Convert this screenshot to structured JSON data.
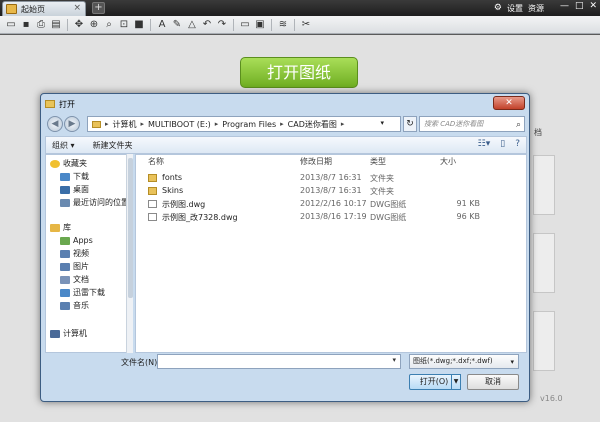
{
  "app": {
    "tab_label": "起始页",
    "tab_close": "×",
    "new_tab": "+",
    "settings": "设置",
    "resources": "资源",
    "win_min": "—",
    "win_max": "□",
    "win_close": "✕"
  },
  "start_page": {
    "open_drawing_label": "打开图纸",
    "side_label": "档",
    "version": "v16.0"
  },
  "dialog": {
    "title": "打开",
    "address": [
      "计算机",
      "MULTIBOOT (E:)",
      "Program Files",
      "CAD迷你看图"
    ],
    "search_placeholder": "搜索 CAD迷你看图",
    "organize": "组织 ▾",
    "new_folder": "新建文件夹",
    "nav": [
      {
        "label": "收藏夹",
        "icon": "star-icon",
        "color": "#f0c030"
      },
      {
        "label": "下载",
        "icon": "download-folder-icon",
        "color": "#4a88c8"
      },
      {
        "label": "桌面",
        "icon": "desktop-icon",
        "color": "#3a6ea8"
      },
      {
        "label": "最近访问的位置",
        "icon": "recent-places-icon",
        "color": "#6a8ab0"
      },
      {
        "label": "库",
        "icon": "library-icon",
        "color": "#e6b645"
      },
      {
        "label": "Apps",
        "icon": "apps-icon",
        "color": "#6aa84f"
      },
      {
        "label": "视频",
        "icon": "video-icon",
        "color": "#5a7fb0"
      },
      {
        "label": "图片",
        "icon": "pictures-icon",
        "color": "#5a7fb0"
      },
      {
        "label": "文档",
        "icon": "documents-icon",
        "color": "#7a93b8"
      },
      {
        "label": "迅雷下载",
        "icon": "thunder-download-icon",
        "color": "#4a88c8"
      },
      {
        "label": "音乐",
        "icon": "music-icon",
        "color": "#5a7fb0"
      },
      {
        "label": "计算机",
        "icon": "computer-icon",
        "color": "#4a6a98"
      }
    ],
    "columns": {
      "name": "名称",
      "modified": "修改日期",
      "type": "类型",
      "size": "大小"
    },
    "files": [
      {
        "name": "fonts",
        "modified": "2013/8/7 16:31",
        "type": "文件夹",
        "size": "",
        "kind": "folder"
      },
      {
        "name": "Skins",
        "modified": "2013/8/7 16:31",
        "type": "文件夹",
        "size": "",
        "kind": "folder"
      },
      {
        "name": "示例图.dwg",
        "modified": "2012/2/16 10:17",
        "type": "DWG图纸",
        "size": "91 KB",
        "kind": "dwg"
      },
      {
        "name": "示例图_改7328.dwg",
        "modified": "2013/8/16 17:19",
        "type": "DWG图纸",
        "size": "96 KB",
        "kind": "dwg"
      }
    ],
    "filename_label": "文件名(N):",
    "filename_value": "",
    "filetype": "图纸(*.dwg;*.dxf;*.dwf)",
    "open_button": "打开(O)",
    "cancel_button": "取消"
  }
}
